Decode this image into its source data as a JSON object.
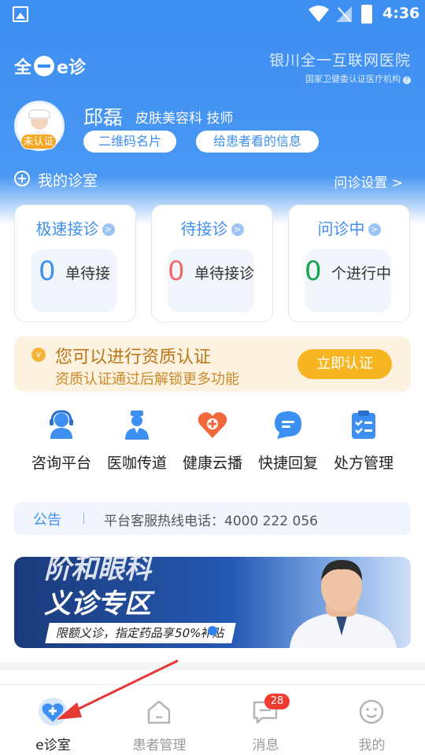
{
  "status_bar": {
    "time": "4:36"
  },
  "header": {
    "logo_text_1": "全",
    "logo_text_2": "e诊",
    "hospital_name": "银川全一互联网医院",
    "hospital_sub": "国家卫健委认证医疗机构"
  },
  "doctor": {
    "name": "邱磊",
    "title": "皮肤美容科  技师",
    "badge": "未认证",
    "qr_button": "二维码名片",
    "info_button": "给患者看的信息"
  },
  "clinic": {
    "title": "我的诊室",
    "settings": "问诊设置 >"
  },
  "cards": [
    {
      "title": "极速接诊",
      "count": "0",
      "unit": "单待接",
      "color": "#3e8ff2"
    },
    {
      "title": "待接诊",
      "count": "0",
      "unit": "单待接诊",
      "color": "#f06a6a"
    },
    {
      "title": "问诊中",
      "count": "0",
      "unit": "个进行中",
      "color": "#1aa34a"
    }
  ],
  "certification": {
    "title": "您可以进行资质认证",
    "subtitle": "资质认证通过后解锁更多功能",
    "button": "立即认证"
  },
  "quick_actions": [
    {
      "label": "咨询平台",
      "icon": "headset-icon"
    },
    {
      "label": "医咖传道",
      "icon": "doctor-icon"
    },
    {
      "label": "健康云播",
      "icon": "heart-plus-icon"
    },
    {
      "label": "快捷回复",
      "icon": "chat-icon"
    },
    {
      "label": "处方管理",
      "icon": "clipboard-icon"
    }
  ],
  "notice": {
    "tag": "公告",
    "text": "平台客服热线电话：4000 222 056"
  },
  "banner": {
    "top_text": "阶和眼科",
    "main_text": "义诊专区",
    "sub_text": "限额义诊，指定药品享50%补贴"
  },
  "tabbar": {
    "tabs": [
      {
        "label": "e诊室",
        "icon": "heart-plus-icon",
        "active": true
      },
      {
        "label": "患者管理",
        "icon": "house-icon",
        "active": false
      },
      {
        "label": "消息",
        "icon": "message-icon",
        "active": false
      },
      {
        "label": "我的",
        "icon": "smile-face-icon",
        "active": false
      }
    ],
    "message_badge": "28"
  },
  "colors": {
    "primary": "#3e8ff2",
    "warning": "#f6b521",
    "badge_red": "#f03b2e",
    "annotation_arrow": "#e53935"
  }
}
